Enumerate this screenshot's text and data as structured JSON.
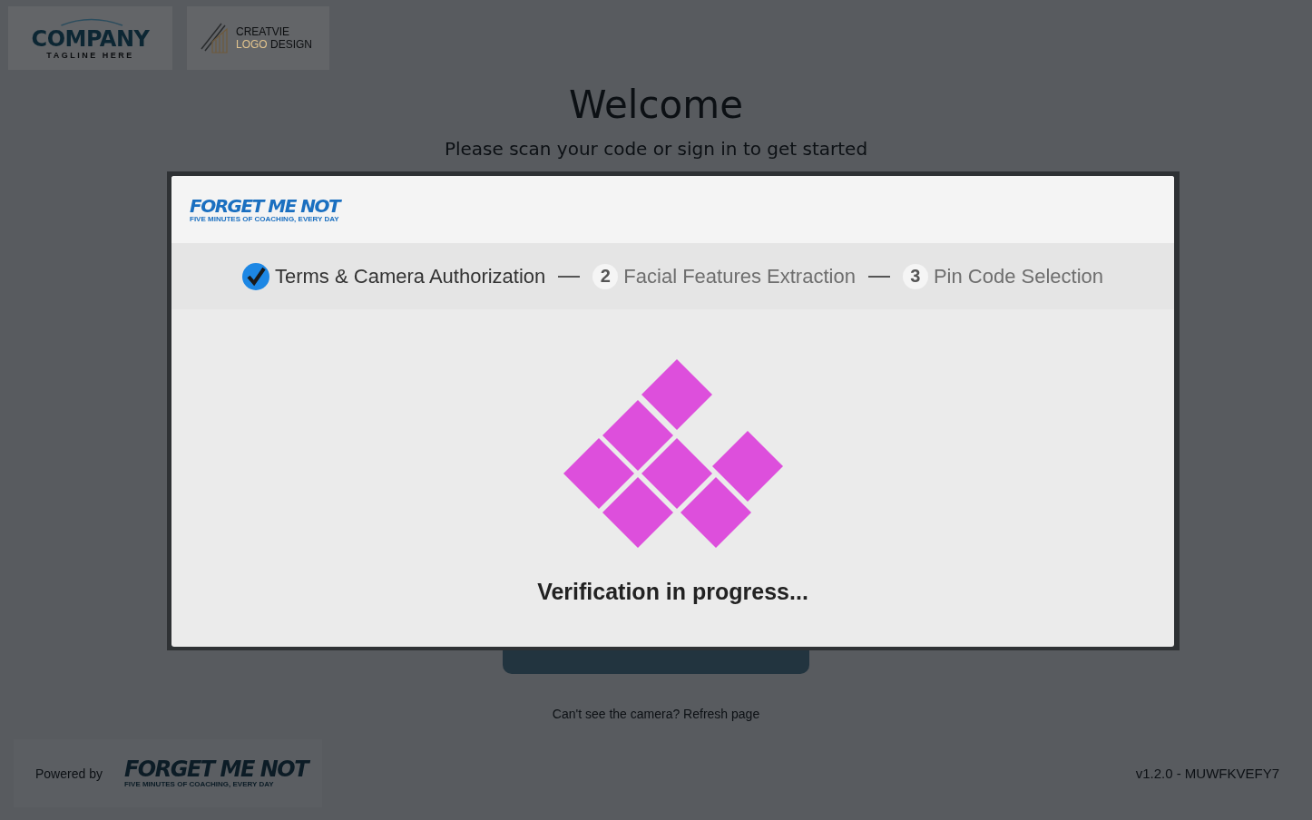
{
  "logos": [
    {
      "kind": "company",
      "name": "COMPANY",
      "tagline": "TAGLINE HERE"
    },
    {
      "kind": "creative",
      "line_1": "CREATVIE",
      "line_2_accent": "LOGO",
      "line_2": "DESIGN"
    }
  ],
  "welcome": {
    "title": "Welcome",
    "subtitle": "Please scan your code or sign in to get started"
  },
  "refresh_note": "Can't see the camera? Refresh page",
  "footer": {
    "powered_by": "Powered by",
    "brand": "FORGET ME NOT",
    "brand_tagline": "FIVE MINUTES OF COACHING, EVERY DAY",
    "version": "v1.2.0 - MUWFKVEFY7"
  },
  "dialog": {
    "brand": "FORGET ME NOT",
    "brand_tagline": "FIVE MINUTES OF COACHING, EVERY DAY",
    "steps": [
      {
        "label": "Terms & Camera Authorization",
        "completed": true
      },
      {
        "number": "2",
        "label": "Facial Features Extraction",
        "completed": false
      },
      {
        "number": "3",
        "label": "Pin Code Selection",
        "completed": false
      }
    ],
    "status": "Verification in progress..."
  }
}
